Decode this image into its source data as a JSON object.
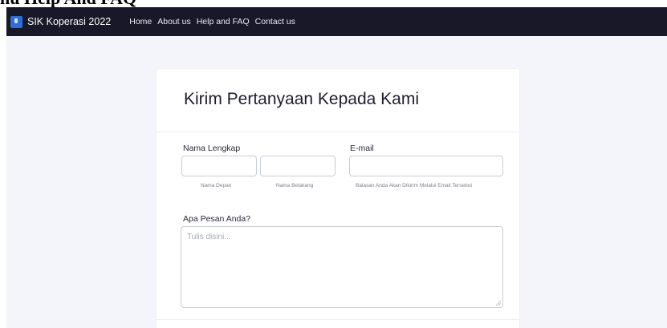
{
  "document": {
    "heading": "nu Help And FAQ"
  },
  "navbar": {
    "brand": "SIK Koperasi 2022",
    "links": [
      "Home",
      "About us",
      "Help and FAQ",
      "Contact us"
    ]
  },
  "form": {
    "title": "Kirim Pertanyaan Kepada Kami",
    "name_label": "Nama Lengkap",
    "first_name_value": "",
    "first_name_hint": "Nama Depan",
    "last_name_value": "",
    "last_name_hint": "Nama Belakang",
    "email_label": "E-mail",
    "email_value": "",
    "email_hint": "Balasan Anda Akan Dikirim Melalui Email Tersebut",
    "message_label": "Apa Pesan Anda?",
    "message_placeholder": "Tulis disini..."
  },
  "colors": {
    "navbar_bg": "#181828",
    "page_bg": "#f4f5fb",
    "brand_logo": "#2d6fd6"
  }
}
